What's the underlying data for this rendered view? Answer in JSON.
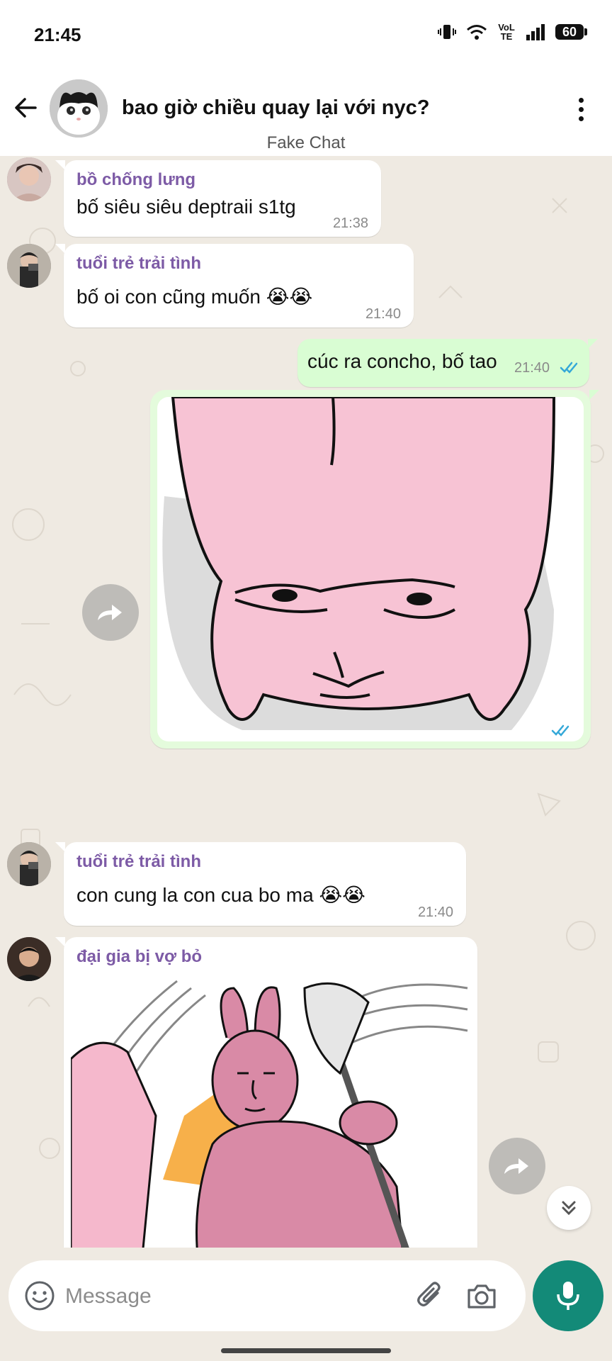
{
  "status_bar": {
    "time": "21:45",
    "network": "VoLTE",
    "battery_level": "60"
  },
  "header": {
    "title": "bao giờ chiều quay lại với nyc?",
    "subtitle": "Fake Chat"
  },
  "messages": [
    {
      "direction": "in",
      "sender": "bồ chống lưng",
      "text": "bố siêu siêu deptraii s1tg",
      "time": "21:38"
    },
    {
      "direction": "in",
      "sender": "tuổi trẻ trải tình",
      "text": "bố oi con cũng muốn 😭😭",
      "time": "21:40"
    },
    {
      "direction": "out",
      "text": "cúc ra concho, bố tao",
      "time": "21:40",
      "status": "read"
    },
    {
      "direction": "out",
      "type": "sticker",
      "sticker": "pink-rabbit-bored-sticker",
      "status": "read"
    },
    {
      "direction": "in",
      "sender": "tuổi trẻ trải tình",
      "text": "con cung la con cua bo ma 😭😭",
      "time": "21:40"
    },
    {
      "direction": "in",
      "sender": "đại gia bị vợ bỏ",
      "type": "sticker",
      "sticker": "pink-rabbit-swinging-sticker"
    }
  ],
  "composer": {
    "placeholder": "Message"
  },
  "icons": {
    "back": "arrow-left-icon",
    "more": "more-vertical-icon",
    "emoji": "smiley-icon",
    "attach": "paperclip-icon",
    "camera": "camera-icon",
    "mic": "microphone-icon",
    "forward": "forward-icon",
    "scroll_down": "double-chevron-down-icon"
  },
  "colors": {
    "accent": "#138a78",
    "sender_name": "#7d5ba6",
    "outgoing_bubble": "#d9fdd3",
    "chat_bg": "#efeae2",
    "read_tick": "#34a8d8"
  }
}
